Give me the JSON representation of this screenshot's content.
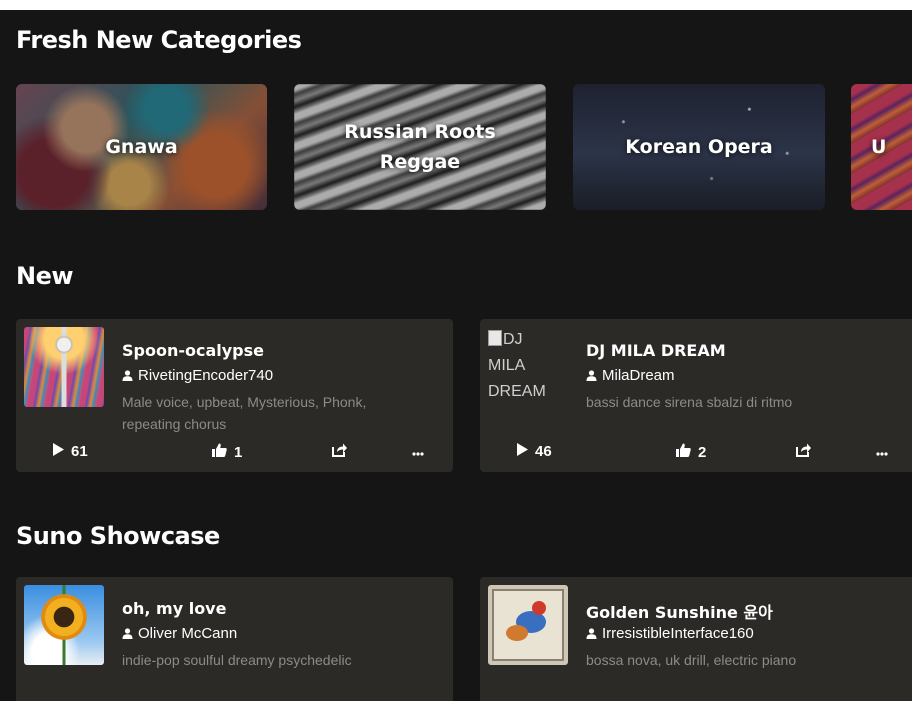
{
  "sections": {
    "fresh_categories": {
      "title": "Fresh New Categories",
      "tiles": [
        {
          "label": "Gnawa"
        },
        {
          "label": "Russian Roots\nReggae"
        },
        {
          "label": "Korean Opera"
        },
        {
          "label": "U"
        }
      ]
    },
    "new": {
      "title": "New",
      "songs": [
        {
          "title": "Spoon-ocalypse",
          "author": "RivetingEncoder740",
          "description": "Male voice, upbeat, Mysterious, Phonk, repeating chorus",
          "plays": "61",
          "likes": "1"
        },
        {
          "title": "DJ MILA DREAM",
          "author": "MilaDream",
          "description": "bassi dance sirena sbalzi di ritmo",
          "plays": "46",
          "likes": "2",
          "cover_alt_lines": [
            "DJ",
            "MILA",
            "DREAM"
          ]
        }
      ]
    },
    "showcase": {
      "title": "Suno Showcase",
      "songs": [
        {
          "title": "oh, my love",
          "author": "Oliver McCann",
          "description": "indie-pop soulful dreamy psychedelic"
        },
        {
          "title": "Golden Sunshine 윤아",
          "author": "IrresistibleInterface160",
          "description": "bossa nova, uk drill, electric piano"
        }
      ]
    }
  },
  "icons": {
    "play": "play-icon",
    "like": "thumbs-up-icon",
    "share": "share-icon",
    "more": "more-options-icon",
    "user": "user-icon"
  },
  "colors": {
    "background": "#151515",
    "card": "#2c2a27",
    "muted_text": "#8e8b86"
  }
}
